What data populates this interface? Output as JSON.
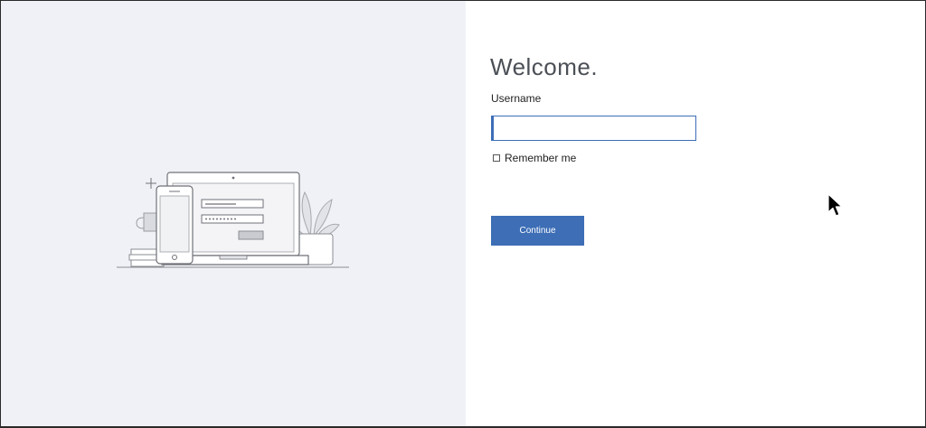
{
  "login": {
    "welcome_title": "Welcome.",
    "username_label": "Username",
    "username_value": "",
    "remember_label": "Remember me",
    "remember_checked": false,
    "continue_label": "Continue"
  },
  "colors": {
    "accent": "#3d6eb6",
    "left_panel_bg": "#f0f1f6",
    "title_text": "#4b4f56"
  },
  "icons": {
    "illustration": "laptop-phone-login-illustration",
    "cursor": "mouse-pointer-icon"
  }
}
